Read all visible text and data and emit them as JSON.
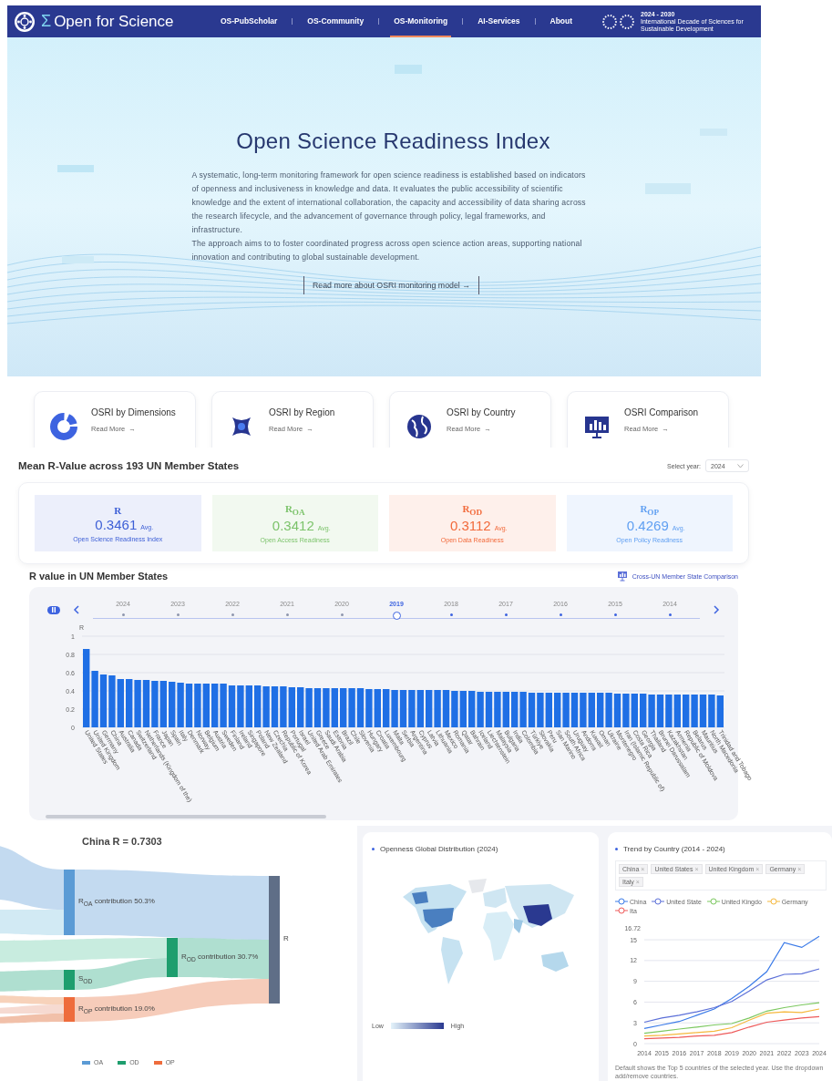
{
  "header": {
    "logo_mark": "Σ",
    "logo_text": "Open for Science",
    "nav": [
      {
        "label": "OS-PubScholar",
        "selected": false
      },
      {
        "label": "OS-Community",
        "selected": false
      },
      {
        "label": "OS-Monitoring",
        "selected": true
      },
      {
        "label": "AI-Services",
        "selected": false
      },
      {
        "label": "About",
        "selected": false
      }
    ],
    "partner_years": "2024 - 2030",
    "partner_caption": "International Decade of Sciences for Sustainable Development"
  },
  "hero": {
    "title": "Open Science Readiness Index",
    "paragraphs": [
      "A systematic, long-term monitoring framework for open science readiness is established based on indicators of openness and inclusiveness in knowledge and data. It evaluates the public accessibility of scientific knowledge and the extent of international collaboration, the capacity and accessibility of data sharing across the research lifecycle, and the advancement of governance through policy, legal frameworks, and infrastructure.",
      "The approach aims to to foster coordinated progress across open science action areas, supporting national innovation and contributing to global sustainable development."
    ],
    "button": "Read more about OSRI monitoring model",
    "button_arrow": "→"
  },
  "feature_cards": [
    {
      "title": "OSRI by Dimensions",
      "link": "Read More",
      "arrow": "→"
    },
    {
      "title": "OSRI by Region",
      "link": "Read More",
      "arrow": "→"
    },
    {
      "title": "OSRI by Country",
      "link": "Read More",
      "arrow": "→"
    },
    {
      "title": "OSRI Comparison",
      "link": "Read More",
      "arrow": "→"
    }
  ],
  "mean_section": {
    "title": "Mean R-Value across 193 UN Member States",
    "year_label": "Select year:",
    "year_value": "2024",
    "metrics": [
      {
        "symbol": "R",
        "value": "0.3461",
        "suffix": "Avg.",
        "caption": "Open Science Readiness Index",
        "color": "#3d5fd6"
      },
      {
        "symbol": "R$_{OA}$",
        "value": "0.3412",
        "suffix": "Avg.",
        "caption": "Open Access Readiness",
        "color": "#7cc36b"
      },
      {
        "symbol": "R$_{OD}$",
        "value": "0.3112",
        "suffix": "Avg.",
        "caption": "Open Data Readiness",
        "color": "#f26a3b"
      },
      {
        "symbol": "R$_{OP}$",
        "value": "0.4269",
        "suffix": "Avg.",
        "caption": "Open Policy Readiness",
        "color": "#5f9ff2"
      }
    ]
  },
  "r_value_section": {
    "title": "R value in UN Member States",
    "compare_link": "Cross-UN Member State Comparison",
    "timeline": [
      {
        "year": "2024",
        "selected": false
      },
      {
        "year": "2023",
        "selected": false
      },
      {
        "year": "2022",
        "selected": false
      },
      {
        "year": "2021",
        "selected": false
      },
      {
        "year": "2020",
        "selected": false
      },
      {
        "year": "2019",
        "selected": true
      },
      {
        "year": "2018",
        "selected": false
      },
      {
        "year": "2017",
        "selected": false
      },
      {
        "year": "2016",
        "selected": false
      },
      {
        "year": "2015",
        "selected": false
      },
      {
        "year": "2014",
        "selected": false
      }
    ],
    "chart_data": {
      "type": "bar",
      "ylabel": "R",
      "ylim": [
        0,
        1
      ],
      "grid": true,
      "yticks": [
        0,
        0.2,
        0.4,
        0.6,
        0.8,
        1
      ],
      "categories": [
        "United States",
        "United Kingdom",
        "Germany",
        "China",
        "Australia",
        "Canada",
        "Switzerland",
        "Netherlands (Kingdom of the)",
        "France",
        "Japan",
        "Spain",
        "Italy",
        "Denmark",
        "Norway",
        "Belgium",
        "Austria",
        "Sweden",
        "Finland",
        "Ireland",
        "Singapore",
        "Poland",
        "New Zealand",
        "Czechia",
        "Republic of Korea",
        "Portugal",
        "Israel",
        "United Arab Emirates",
        "Greece",
        "Saudi Arabia",
        "Estonia",
        "Brazil",
        "Chile",
        "Slovenia",
        "Hungary",
        "Croatia",
        "Luxembourg",
        "Malta",
        "Serbia",
        "Argentina",
        "Cyprus",
        "Latvia",
        "Lithuania",
        "Mexico",
        "Romania",
        "Qatar",
        "Bahrain",
        "Iceland",
        "Liechtenstein",
        "Malaysia",
        "Bulgaria",
        "India",
        "Colombia",
        "Türkiye",
        "Slovakia",
        "Peru",
        "San Marino",
        "South Africa",
        "Uruguay",
        "Andorra",
        "Kuwait",
        "Oman",
        "Ukraine",
        "Montenegro",
        "Iran (Islamic Republic of)",
        "Costa Rica",
        "Georgia",
        "Thailand",
        "Brunei Darussalam",
        "Kazakhstan",
        "Armenia",
        "Republic of Moldova",
        "Belarus",
        "Mauritius",
        "North Macedonia",
        "Trinidad and Tobago"
      ],
      "values": [
        0.86,
        0.62,
        0.58,
        0.57,
        0.53,
        0.53,
        0.52,
        0.52,
        0.51,
        0.51,
        0.5,
        0.49,
        0.48,
        0.48,
        0.48,
        0.48,
        0.48,
        0.46,
        0.46,
        0.46,
        0.46,
        0.45,
        0.45,
        0.45,
        0.44,
        0.44,
        0.43,
        0.43,
        0.43,
        0.43,
        0.43,
        0.43,
        0.43,
        0.42,
        0.42,
        0.42,
        0.41,
        0.41,
        0.41,
        0.41,
        0.41,
        0.41,
        0.41,
        0.4,
        0.4,
        0.4,
        0.39,
        0.39,
        0.39,
        0.39,
        0.39,
        0.39,
        0.38,
        0.38,
        0.38,
        0.38,
        0.38,
        0.38,
        0.38,
        0.38,
        0.38,
        0.38,
        0.37,
        0.37,
        0.37,
        0.37,
        0.36,
        0.36,
        0.36,
        0.36,
        0.36,
        0.36,
        0.36,
        0.36,
        0.35
      ]
    }
  },
  "contribution": {
    "title": "China  R = 0.7303",
    "nodes": [
      {
        "label": "R$_{OA}$ contribution 50.3%"
      },
      {
        "label": "S$_{OD}$"
      },
      {
        "label": "R$_{OP}$ contribution 19.0%"
      },
      {
        "label": "R$_{OD}$ contribution 30.7%"
      },
      {
        "label": "R"
      }
    ],
    "legend": [
      {
        "label": "OA",
        "color": "#5b9bd5"
      },
      {
        "label": "OD",
        "color": "#1e9e6e"
      },
      {
        "label": "OP",
        "color": "#ee6c3c"
      }
    ]
  },
  "map_panel": {
    "title": "Openness Global Distribution (2024)",
    "legend_low": "Low",
    "legend_high": "High"
  },
  "trend_panel": {
    "title": "Trend by Country (2014 - 2024)",
    "tags": [
      {
        "label": "China",
        "remove": "×"
      },
      {
        "label": "United States",
        "remove": "×"
      },
      {
        "label": "United Kingdom",
        "remove": "×"
      },
      {
        "label": "Germany",
        "remove": "×"
      },
      {
        "label": "Italy",
        "remove": "×"
      }
    ],
    "chart_data": {
      "type": "line",
      "grid": true,
      "x": [
        "2014",
        "2015",
        "2016",
        "2017",
        "2018",
        "2019",
        "2020",
        "2021",
        "2022",
        "2023",
        "2024"
      ],
      "ylim": [
        0,
        16.72
      ],
      "yticks": [
        0,
        3,
        6,
        9,
        12,
        15,
        {
          "value": 16.72,
          "label": "16.72"
        }
      ],
      "series": [
        {
          "name": "China",
          "color": "#3b7be8",
          "values": [
            2.2,
            2.7,
            3.2,
            4.1,
            5.0,
            6.5,
            8.3,
            10.4,
            14.6,
            13.9,
            15.5
          ]
        },
        {
          "name": "United State",
          "color": "#5b6fd8",
          "values": [
            3.1,
            3.7,
            4.1,
            4.6,
            5.2,
            6.1,
            7.6,
            9.2,
            10.0,
            10.1,
            10.8
          ]
        },
        {
          "name": "United Kingdo",
          "color": "#7cc860",
          "values": [
            1.5,
            1.8,
            2.1,
            2.4,
            2.7,
            2.9,
            3.7,
            4.7,
            5.2,
            5.6,
            5.9
          ]
        },
        {
          "name": "Germany",
          "color": "#f5b83d",
          "values": [
            1.1,
            1.2,
            1.4,
            1.6,
            1.8,
            2.3,
            3.4,
            4.4,
            4.6,
            4.5,
            5.0
          ]
        },
        {
          "name": "Ita",
          "color": "#ee5a5a",
          "values": [
            0.7,
            0.8,
            0.9,
            1.1,
            1.2,
            1.6,
            2.4,
            3.1,
            3.4,
            3.7,
            3.9
          ]
        }
      ]
    },
    "note": [
      "Default shows the Top 5 countries of the selected year. Use the dropdown",
      "add/remove countries."
    ]
  }
}
